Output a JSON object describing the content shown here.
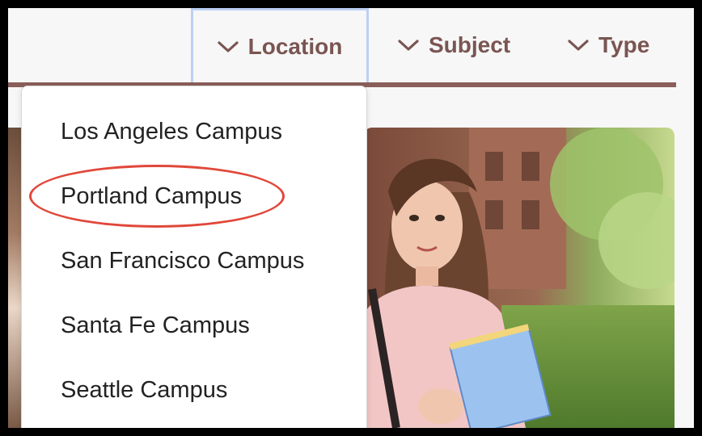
{
  "nav": {
    "items": [
      {
        "label": "Location"
      },
      {
        "label": "Subject"
      },
      {
        "label": "Type"
      }
    ]
  },
  "dropdown": {
    "items": [
      {
        "label": "Los Angeles Campus"
      },
      {
        "label": "Portland Campus"
      },
      {
        "label": "San Francisco Campus"
      },
      {
        "label": "Santa Fe Campus"
      },
      {
        "label": "Seattle Campus"
      }
    ],
    "highlighted": "Portland Campus"
  },
  "colors": {
    "nav_text": "#7a5552",
    "nav_rule": "#8a5e5a",
    "focus_outline": "#bcd0f5",
    "highlight_ring": "#e0483a"
  },
  "icons": {
    "nav_dropdown": "chevron-down-icon"
  }
}
